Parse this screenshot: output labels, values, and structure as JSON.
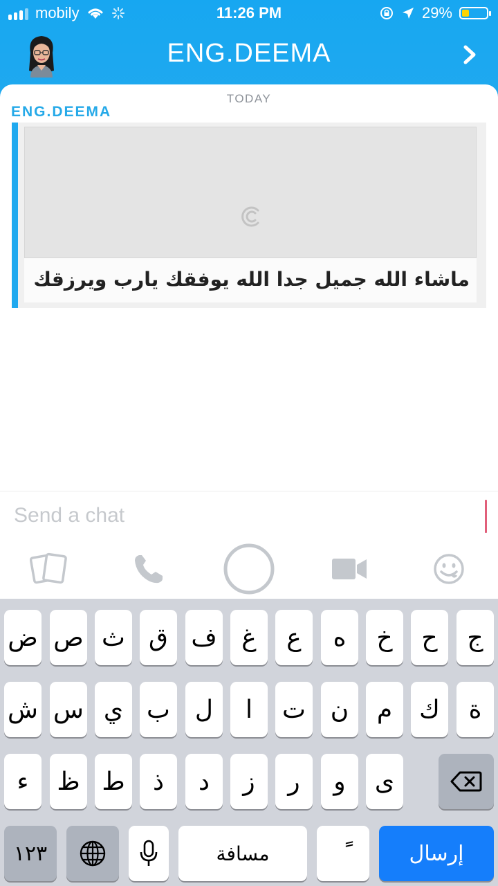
{
  "status": {
    "carrier": "mobily",
    "time": "11:26 PM",
    "battery": "29%",
    "battery_level": 0.29
  },
  "header": {
    "title": "ENG.DEEMA"
  },
  "chat": {
    "date_label": "TODAY",
    "sender": "ENG.DEEMA",
    "message_caption": "ماشاء الله جميل جدا الله يوفقك يارب ويرزقك"
  },
  "input": {
    "placeholder": "Send a chat"
  },
  "actions": [
    "memories-icon",
    "phone-icon",
    "capture-circle-icon",
    "video-icon",
    "emoji-icon"
  ],
  "keyboard": {
    "row1": [
      "ض",
      "ص",
      "ث",
      "ق",
      "ف",
      "غ",
      "ع",
      "ه",
      "خ",
      "ح",
      "ج"
    ],
    "row2": [
      "ش",
      "س",
      "ي",
      "ب",
      "ل",
      "ا",
      "ت",
      "ن",
      "م",
      "ك",
      "ة"
    ],
    "row3": [
      "ء",
      "ظ",
      "ط",
      "ذ",
      "د",
      "ز",
      "ر",
      "و",
      "ى"
    ],
    "numbers_key": "١٢٣",
    "space_key": "مسافة",
    "diacritic_key": "ً",
    "send_key": "إرسال"
  },
  "colors": {
    "brand_blue": "#1fa9ef",
    "send_blue": "#157efb",
    "cursor_pink": "#e15f7a"
  }
}
